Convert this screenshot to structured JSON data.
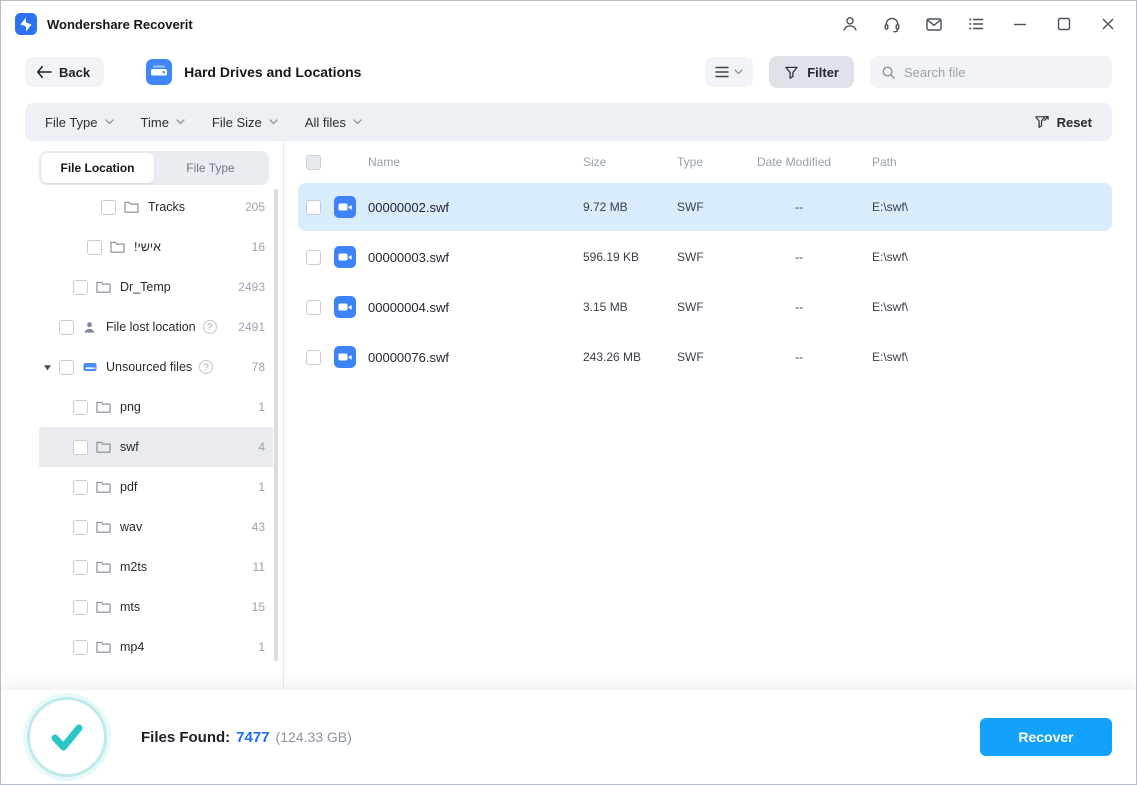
{
  "titlebar": {
    "app_name": "Wondershare Recoverit",
    "action_icons": [
      "account",
      "support",
      "inbox",
      "task-list"
    ],
    "window_controls": [
      "minimize",
      "maximize",
      "close"
    ]
  },
  "toolbar": {
    "back_label": "Back",
    "title": "Hard Drives and Locations",
    "filter_label": "Filter",
    "search_placeholder": "Search file"
  },
  "filter_bar": {
    "filters": [
      {
        "label": "File Type"
      },
      {
        "label": "Time"
      },
      {
        "label": "File Size"
      },
      {
        "label": "All files"
      }
    ],
    "reset_label": "Reset"
  },
  "sidebar": {
    "tabs": [
      {
        "label": "File Location",
        "active": true
      },
      {
        "label": "File Type",
        "active": false
      }
    ],
    "items": [
      {
        "label": "Tracks",
        "count": "205",
        "icon": "folder",
        "depth": 4
      },
      {
        "label": "!אישי",
        "count": "16",
        "icon": "folder",
        "depth": 3
      },
      {
        "label": "Dr_Temp",
        "count": "2493",
        "icon": "folder",
        "depth": 2
      },
      {
        "label": "File lost location",
        "count": "2491",
        "icon": "user",
        "depth": 1,
        "help": true
      },
      {
        "label": "Unsourced files",
        "count": "78",
        "icon": "drive",
        "depth": 1,
        "help": true,
        "expanded": true
      },
      {
        "label": "png",
        "count": "1",
        "icon": "folder",
        "depth": 2
      },
      {
        "label": "swf",
        "count": "4",
        "icon": "folder",
        "depth": 2,
        "selected": true
      },
      {
        "label": "pdf",
        "count": "1",
        "icon": "folder",
        "depth": 2
      },
      {
        "label": "wav",
        "count": "43",
        "icon": "folder",
        "depth": 2
      },
      {
        "label": "m2ts",
        "count": "11",
        "icon": "folder",
        "depth": 2
      },
      {
        "label": "mts",
        "count": "15",
        "icon": "folder",
        "depth": 2
      },
      {
        "label": "mp4",
        "count": "1",
        "icon": "folder",
        "depth": 2
      }
    ]
  },
  "table": {
    "columns": [
      "Name",
      "Size",
      "Type",
      "Date Modified",
      "Path"
    ],
    "rows": [
      {
        "name": "00000002.swf",
        "size": "9.72 MB",
        "type": "SWF",
        "date": "--",
        "path": "E:\\swf\\",
        "selected": true
      },
      {
        "name": "00000003.swf",
        "size": "596.19 KB",
        "type": "SWF",
        "date": "--",
        "path": "E:\\swf\\"
      },
      {
        "name": "00000004.swf",
        "size": "3.15 MB",
        "type": "SWF",
        "date": "--",
        "path": "E:\\swf\\"
      },
      {
        "name": "00000076.swf",
        "size": "243.26 MB",
        "type": "SWF",
        "date": "--",
        "path": "E:\\swf\\"
      }
    ]
  },
  "footer": {
    "files_found_label": "Files Found:",
    "files_found_count": "7477",
    "files_found_size": "(124.33 GB)",
    "recover_label": "Recover"
  },
  "colors": {
    "accent_blue": "#2a72f0",
    "recover_button": "#12a2fc",
    "selected_row": "#d9ecfc",
    "sidebar_selected": "#e9ebef",
    "filter_bar_bg": "#edf0f4",
    "check_teal": "#2ac7c9",
    "count_gray": "#9aa3ae"
  }
}
